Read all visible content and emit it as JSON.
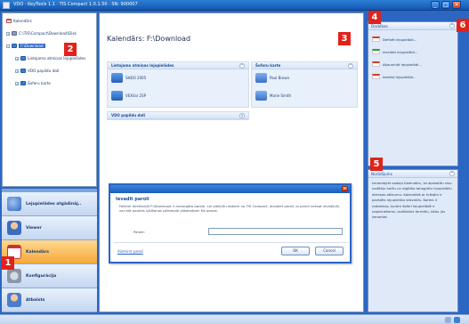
{
  "window": {
    "title": "VDO · KeyTools 1.1 · TIS Compact 1.0.1.50 · SN: 900007",
    "buttons": {
      "min": "_",
      "max": "□",
      "close": "×"
    }
  },
  "tree": {
    "items": [
      {
        "label": "Kalendārs"
      },
      {
        "label": "C:\\TIS\\Compact\\Download\\Disk"
      },
      {
        "label": "F:\\Download"
      },
      {
        "label": "Lietojamo atmiņas lejupielādes"
      },
      {
        "label": "VDO papildu dati"
      },
      {
        "label": "Šoferu karte"
      }
    ]
  },
  "nav": {
    "items": [
      {
        "label": "Lejupielādes atgādināj.."
      },
      {
        "label": "Viewer"
      },
      {
        "label": "Kalendārs"
      },
      {
        "label": "Konfigurācija"
      },
      {
        "label": "Atbalsts"
      }
    ]
  },
  "main": {
    "title": "Kalendārs: F:\\Download",
    "sections": {
      "mem": {
        "title": "Lietojamo atmiņas lejupielādes",
        "items": [
          "SHDO 2005",
          "VEXilar 2SP"
        ]
      },
      "cards": {
        "title": "Šoferu karte",
        "items": [
          "Paul Brown",
          "Marie Smith"
        ]
      },
      "extra": {
        "title": "VDO papildu dati"
      }
    }
  },
  "tasks": {
    "title": "Darbības",
    "items": [
      "Definēt lejupielādi...",
      "Izveidot lejupielādi...",
      "Atjaunināt lejupielādi...",
      "Izdzēst lejupielādi..."
    ]
  },
  "help": {
    "title": "Norādījums",
    "text": "Izmantojiet sadaļu Kalendārs, lai apskatītu visu vadītāju karšu un digitālo tahogrāfu lejupielāžu atmiņas atlikumu. Kalendārā ar krāsām ir parādīts lejupielāžu stāvoklis. Kartes ir redzamas, kurām šoferi lejupielādē ir nepieciešams. Izvēlieties formātu, kādu jūs izmantot."
  },
  "dialog": {
    "heading": "Ievadīt paroli",
    "text": "Failiem direktorijā F:\\Download ir aizsargāta parole. Lai piekļūtu datiem no TIS Compact, ievadiet paroli. Ja paroli neesat ievadījuši, var būt paroles sūtīšanas pārbaude sākotnējam šīs parole.",
    "password_label": "Parole:",
    "password_value": "",
    "link": "Aizmirst paroli",
    "ok": "OK",
    "cancel": "Cancel"
  },
  "callouts": [
    "1",
    "2",
    "3",
    "4",
    "5",
    "6"
  ]
}
